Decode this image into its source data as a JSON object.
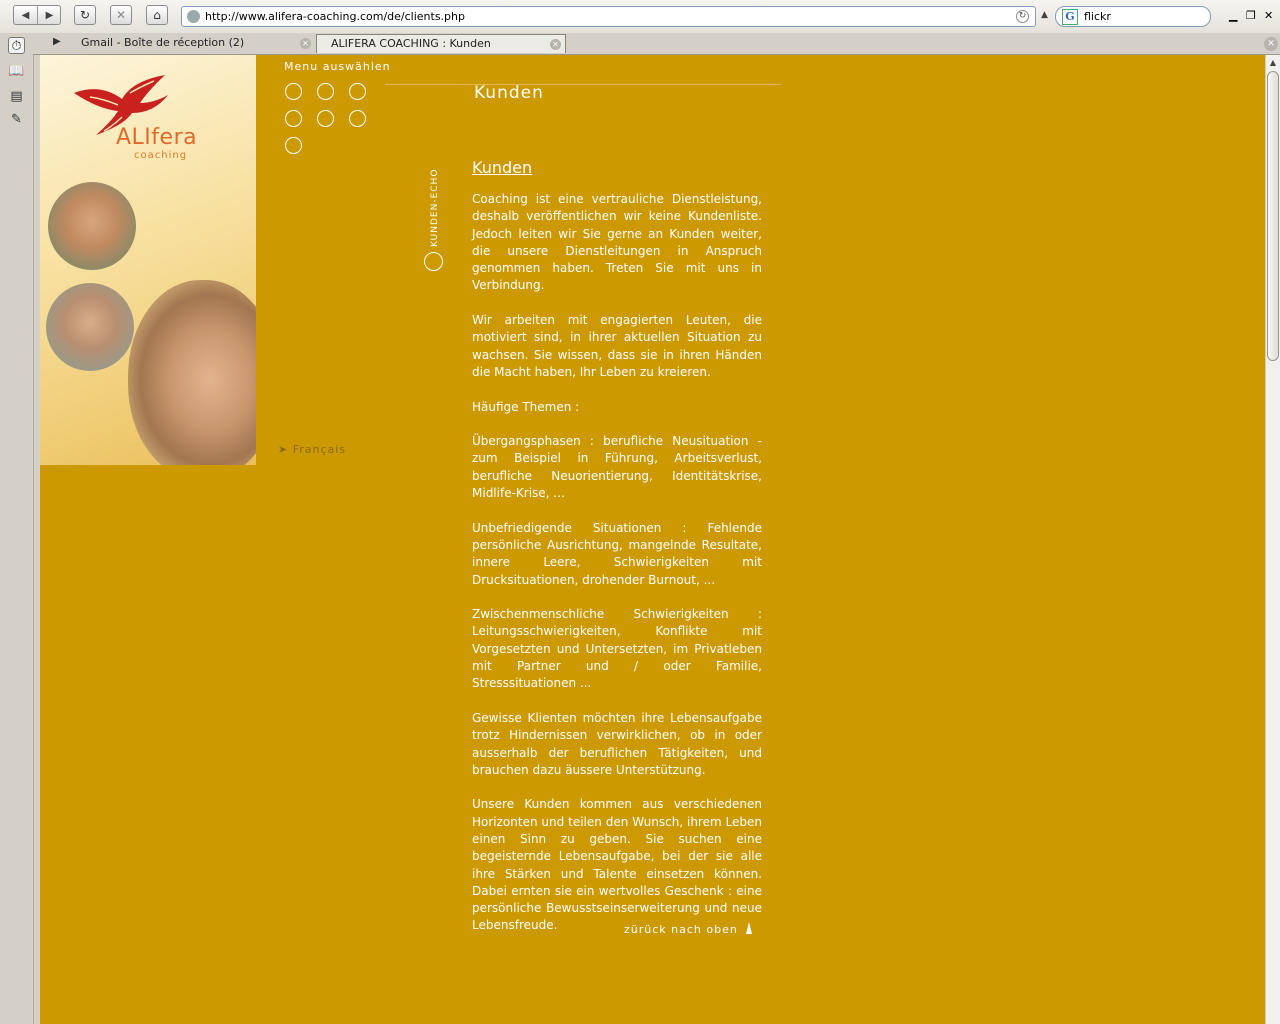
{
  "browser": {
    "url": "http://www.alifera-coaching.com/de/clients.php",
    "search_value": "flickr",
    "tabs": [
      {
        "label": "Gmail - Boîte de réception (2)",
        "active": false
      },
      {
        "label": "ALIFERA COACHING : Kunden",
        "active": true
      }
    ],
    "icons": [
      "back-icon",
      "forward-icon",
      "reload-icon",
      "stop-icon",
      "home-icon",
      "site-icon",
      "go-icon",
      "google-icon",
      "minimize-icon",
      "restore-icon"
    ]
  },
  "site": {
    "logo_text": "ALIfera",
    "logo_sub": "coaching",
    "menu_title": "Menu auswählen",
    "vertical_label": "KUNDEN-ECHO",
    "lang_link": "Français",
    "page_title": "Kunden",
    "back_to_top": "zürück nach oben"
  },
  "content": {
    "heading": "Kunden",
    "paragraphs": [
      "Coaching ist eine vertrauliche Dienstleistung, deshalb veröffentlichen wir keine Kundenliste. Jedoch leiten wir Sie gerne an Kunden weiter, die unsere Dienstleitungen in Anspruch genommen haben. Treten Sie mit uns in Verbindung.",
      "Wir arbeiten mit engagierten Leuten, die motiviert sind, in ihrer aktuellen Situation zu wachsen. Sie wissen, dass sie in ihren Händen die Macht haben, Ihr Leben zu kreieren.",
      "Häufige Themen :",
      "Übergangsphasen : berufliche Neusituation - zum Beispiel in Führung, Arbeitsverlust, berufliche Neuorientierung, Identitätskrise, Midlife-Krise, ...",
      "Unbefriedigende Situationen : Fehlende persönliche Ausrichtung, mangelnde Resultate, innere Leere, Schwierigkeiten mit Drucksituationen, drohender Burnout, ...",
      "Zwischenmenschliche Schwierigkeiten : Leitungsschwierigkeiten, Konflikte mit Vorgesetzten und Untersetzten, im Privatleben mit Partner und / oder Familie, Stresssituationen ...",
      "Gewisse Klienten möchten ihre Lebensaufgabe trotz Hindernissen verwirklichen, ob in oder ausserhalb der beruflichen Tätigkeiten, und brauchen dazu äussere Unterstützung.",
      "Unsere Kunden kommen aus verschiedenen Horizonten und teilen den Wunsch, ihrem Leben einen Sinn zu geben. Sie suchen eine begeisternde Lebensaufgabe, bei der sie alle ihre Stärken und Talente einsetzen können. Dabei ernten sie ein wertvolles Geschenk : eine persönliche Bewusstseinserweiterung und neue Lebensfreude."
    ]
  },
  "colors": {
    "page_bg": "#cc9900",
    "accent_orange": "#e06a2a",
    "text": "#ffffff"
  }
}
